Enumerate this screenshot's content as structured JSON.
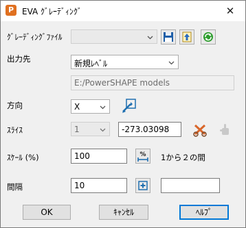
{
  "window": {
    "app_icon_letter": "P",
    "title": "EVA ｸﾞﾚｰﾃﾞｨﾝｸﾞ",
    "close_glyph": "✕"
  },
  "grading_file": {
    "label": "ｸﾞﾚｰﾃﾞｨﾝｸﾞﾌｧｲﾙ",
    "value": ""
  },
  "output": {
    "label": "出力先",
    "selected": "新規ﾚﾍﾞﾙ",
    "path": "E:/PowerSHAPE models"
  },
  "direction": {
    "label": "方向",
    "selected": "X"
  },
  "slice": {
    "label": "ｽﾗｲｽ",
    "selected": "1",
    "value": "-273.03098"
  },
  "scale": {
    "label": "ｽｹｰﾙ (%)",
    "value": "100",
    "range_text": "1から２の間"
  },
  "interval": {
    "label": "間隔",
    "value": "10",
    "value2": ""
  },
  "buttons": {
    "ok": "OK",
    "cancel": "ｷｬﾝｾﾙ",
    "help": "ﾍﾙﾌﾟ"
  },
  "colors": {
    "accent": "#0078d7",
    "app_icon": "#e07020",
    "reset_icon": "#2f9e2f",
    "save_icon": "#1f5fa8",
    "cut_icon": "#d9662a"
  }
}
